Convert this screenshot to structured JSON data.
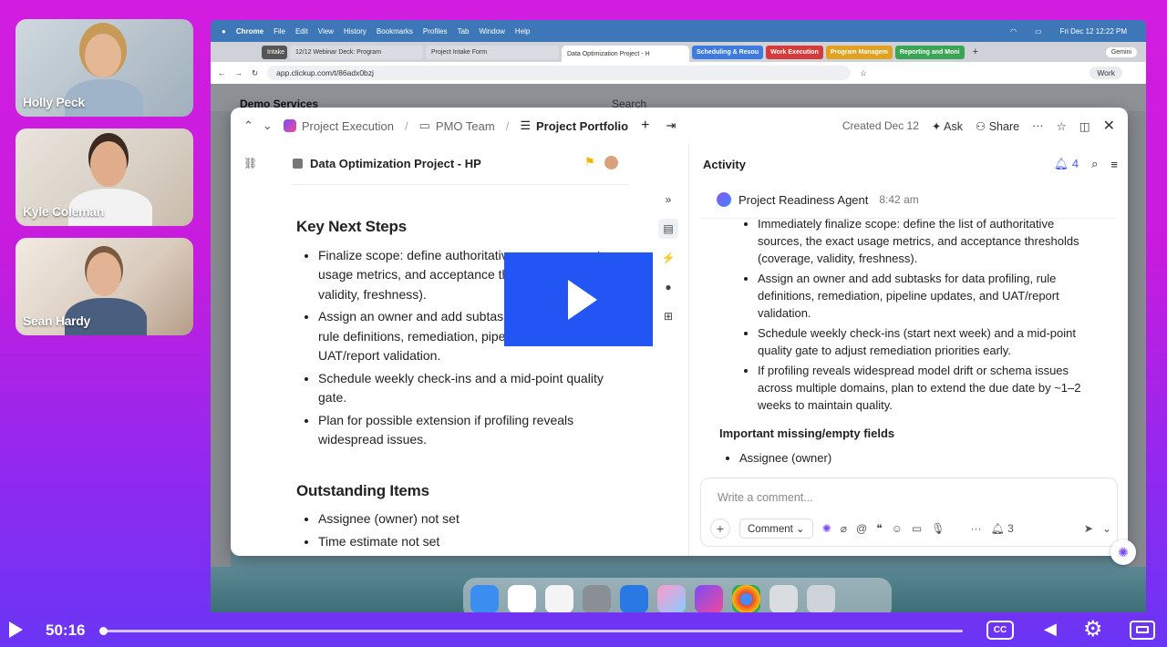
{
  "participants": [
    {
      "name": "Holly Peck"
    },
    {
      "name": "Kyle Coleman"
    },
    {
      "name": "Sean Hardy"
    }
  ],
  "mac": {
    "menu": [
      "Chrome",
      "File",
      "Edit",
      "View",
      "History",
      "Bookmarks",
      "Profiles",
      "Tab",
      "Window",
      "Help"
    ],
    "clock": "Fri Dec 12  12:22 PM"
  },
  "browser": {
    "tabs": [
      "Intake",
      "12/12 Webinar Deck: Program",
      "Project Intake Form",
      "Data Optimization Project - H"
    ],
    "tab_groups": [
      {
        "label": "Scheduling & Resou",
        "color": "#3d7be0"
      },
      {
        "label": "Work Execution",
        "color": "#d63b3b"
      },
      {
        "label": "Program Managem",
        "color": "#e0a21f"
      },
      {
        "label": "Reporting and Moni",
        "color": "#3aa655"
      }
    ],
    "gemini": "Gemini",
    "url": "app.clickup.com/t/86adx0bzj",
    "profile": "Work"
  },
  "clickup": {
    "workspace": "Demo Services",
    "search": "Search"
  },
  "modal": {
    "breadcrumb": [
      "Project Execution",
      "PMO Team",
      "Project Portfolio"
    ],
    "created": "Created Dec 12",
    "ask": "Ask",
    "share": "Share",
    "task_title": "Data Optimization Project - HP",
    "sections": [
      {
        "heading": "Key Next Steps",
        "items": [
          "Finalize scope: define authoritative sources, exact usage metrics, and acceptance thresholds (coverage, validity, freshness).",
          "Assign an owner and add subtasks for data profiling, rule definitions, remediation, pipeline updates, and UAT/report validation.",
          "Schedule weekly check-ins and a mid-point quality gate.",
          "Plan for possible extension if profiling reveals widespread issues."
        ]
      },
      {
        "heading": "Outstanding Items",
        "items": [
          "Assignee (owner) not set",
          "Time estimate not set"
        ]
      }
    ]
  },
  "activity": {
    "title": "Activity",
    "notif_count": "4",
    "agent": "Project Readiness Agent",
    "time": "8:42 am",
    "items": [
      "Immediately finalize scope: define the list of authoritative sources, the exact usage metrics, and acceptance thresholds (coverage, validity, freshness).",
      "Assign an owner and add subtasks for data profiling, rule definitions, remediation, pipeline updates, and UAT/report validation.",
      "Schedule weekly check-ins (start next week) and a mid-point quality gate to adjust remediation priorities early.",
      "If profiling reveals widespread model drift or schema issues across multiple domains, plan to extend the due date by ~1–2 weeks to maintain quality."
    ],
    "missing_heading": "Important missing/empty fields",
    "missing_items": [
      "Assignee (owner)"
    ],
    "comment_placeholder": "Write a comment...",
    "comment_button": "Comment",
    "watchers": "3"
  },
  "player": {
    "time": "50:16",
    "progress": 0.001,
    "cc": "CC"
  }
}
